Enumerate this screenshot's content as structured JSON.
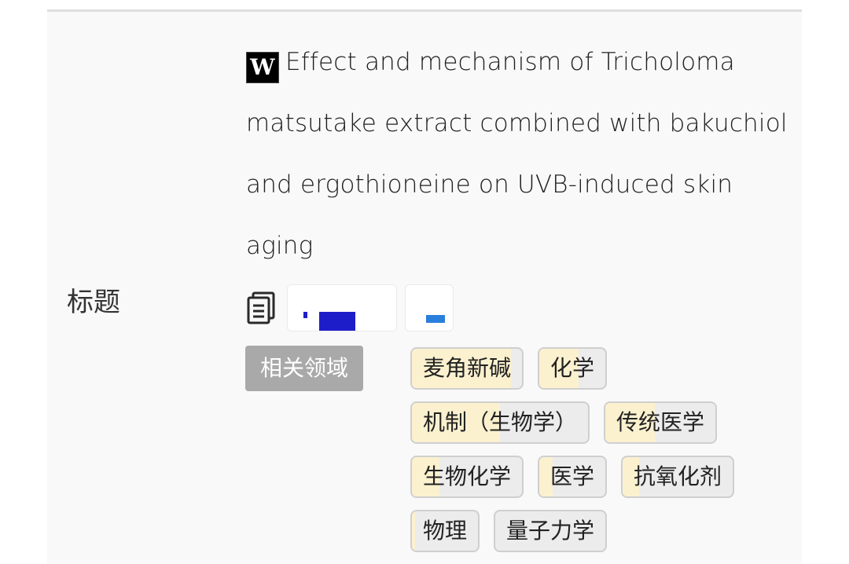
{
  "row": {
    "label": "标题",
    "title_badge": "W",
    "title": "Effect and mechanism of Tricholoma matsutake extract combined with bakuchiol and ergothioneine on UVB-induced skin aging"
  },
  "icons": {
    "copy": "copy-document-icon",
    "wikipedia": "wikipedia-w-icon"
  },
  "related_fields": {
    "button_label": "相关领域",
    "tags": [
      {
        "label": "麦角新碱",
        "relevance": 0.9
      },
      {
        "label": "化学",
        "relevance": 0.6
      },
      {
        "label": "机制（生物学）",
        "relevance": 0.5
      },
      {
        "label": "传统医学",
        "relevance": 0.45
      },
      {
        "label": "生物化学",
        "relevance": 0.25
      },
      {
        "label": "医学",
        "relevance": 0.2
      },
      {
        "label": "抗氧化剂",
        "relevance": 0.15
      },
      {
        "label": "物理",
        "relevance": 0.05
      },
      {
        "label": "量子力学",
        "relevance": 0.0
      }
    ]
  },
  "colors": {
    "tag_fill": "#fbf1cf",
    "tag_bg": "#ececec",
    "button_bg": "#a9a9a9",
    "redaction_blue": "#1d1ec9",
    "redaction_light_blue": "#2b7fdc"
  }
}
